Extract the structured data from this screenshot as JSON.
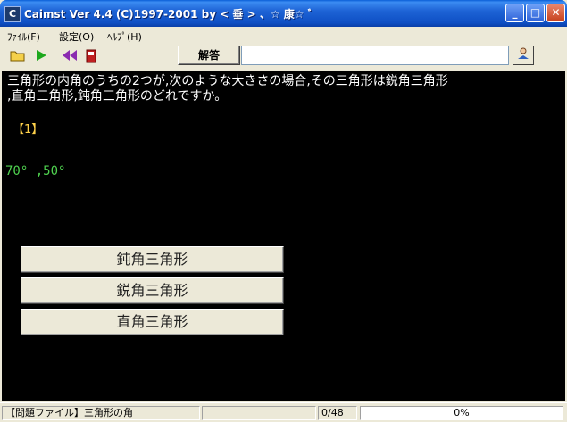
{
  "window": {
    "title": "Caimst Ver 4.4 (C)1997-2001  by < 垂 > 、☆ 康☆ ﾞ",
    "buttons": {
      "minimize": "_",
      "maximize": "□",
      "close": "✕"
    }
  },
  "menu": {
    "items": [
      "ﾌｧｲﾙ(F)",
      "設定(O)",
      "ﾍﾙﾌﾟ(H)"
    ]
  },
  "toolbar": {
    "icons": [
      "open-folder-icon",
      "play-icon",
      "rewind-icon",
      "stop-icon"
    ],
    "answer_label": "解答",
    "answer_value": ""
  },
  "content": {
    "question": "三角形の内角のうちの2つが,次のような大きさの場合,その三角形は鋭角三角形\n,直角三角形,鈍角三角形のどれですか。",
    "number": "【1】",
    "values": "70° ,50°",
    "choices": [
      "鈍角三角形",
      "鋭角三角形",
      "直角三角形"
    ]
  },
  "status": {
    "file": "【問題ファイル】三角形の角",
    "blank": "",
    "count": "0/48",
    "progress": "0%"
  },
  "colors": {
    "content_bg": "#000000",
    "question_text": "#ffffff",
    "number_text": "#ffd24a",
    "values_text": "#4fd24f"
  }
}
